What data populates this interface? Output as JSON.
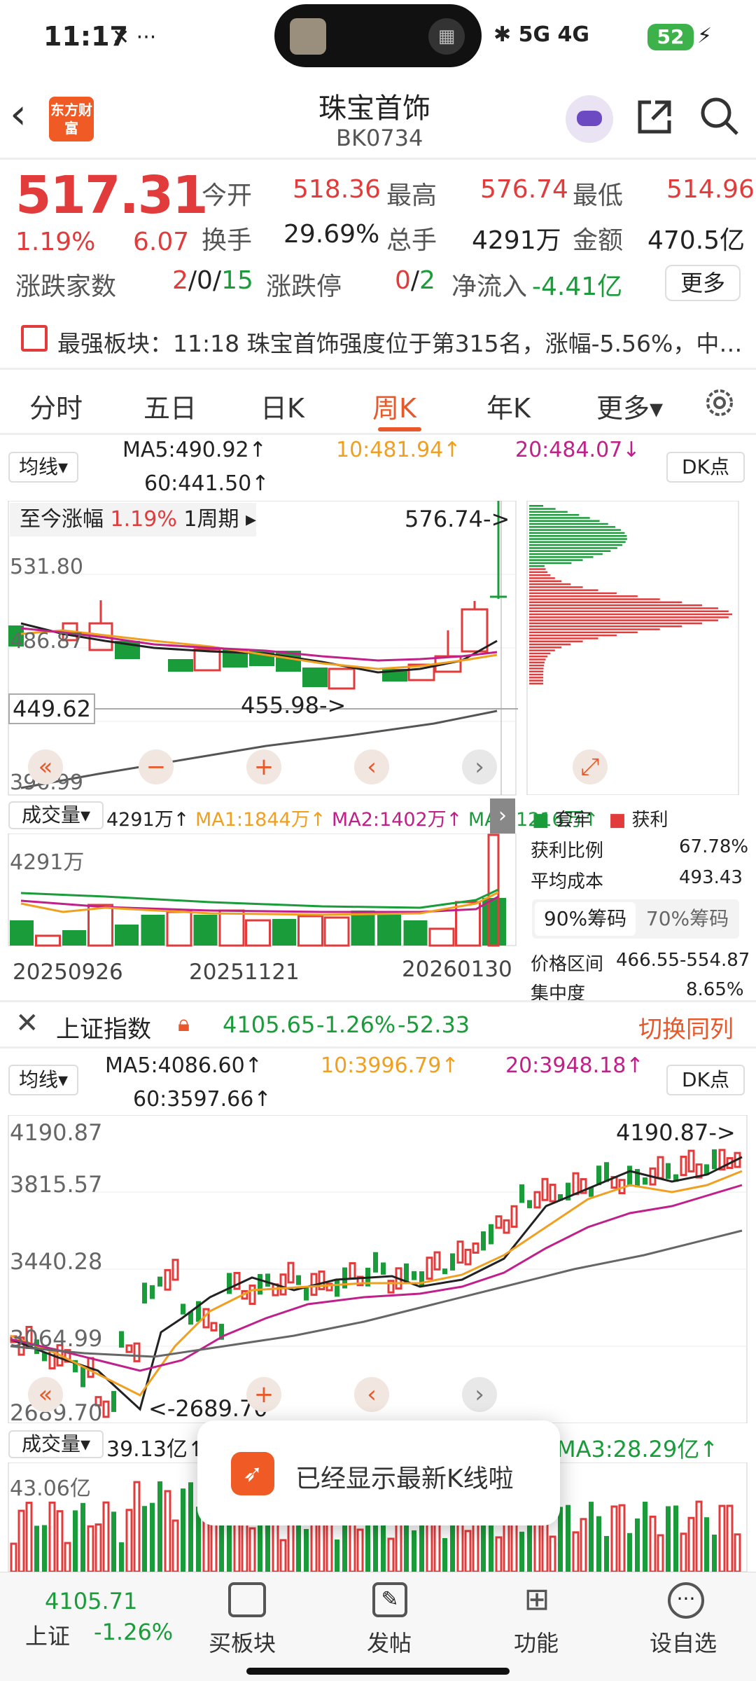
{
  "status": {
    "time": "11:17",
    "battery": "52",
    "signal": "5G 4G"
  },
  "header": {
    "title": "珠宝首饰",
    "code": "BK0734",
    "logo_text": "东方财富"
  },
  "quote": {
    "price": "517.31",
    "pct": "1.19%",
    "change": "6.07",
    "open_label": "今开",
    "open": "518.36",
    "high_label": "最高",
    "high": "576.74",
    "low_label": "最低",
    "low": "514.96",
    "turnover_label": "换手",
    "turnover": "29.69%",
    "volume_label": "总手",
    "volume": "4291万",
    "amount_label": "金额",
    "amount": "470.5亿",
    "updown_label": "涨跌家数",
    "up": "2",
    "flat": "0",
    "down": "15",
    "limit_label": "涨跌停",
    "limit_up": "0",
    "limit_down": "2",
    "inflow_label": "净流入",
    "inflow": "-4.41亿",
    "more": "更多"
  },
  "notice": {
    "text": "最强板块：11:18 珠宝首饰强度位于第315名，涨幅-5.56%，中…"
  },
  "tabs": {
    "t1": "分时",
    "t2": "五日",
    "t3": "日K",
    "t4": "周K",
    "t5": "年K",
    "t6": "更多▾"
  },
  "main_chart": {
    "ma_selector": "均线▾",
    "ma5": "MA5:490.92↑",
    "ma10": "10:481.94↑",
    "ma20": "20:484.07↓",
    "ma60": "60:441.50↑",
    "dk": "DK点",
    "since_label": "至今涨幅",
    "since_pct": "1.19%",
    "since_period": "1周期 ▸",
    "y_top": "531.80",
    "y_mid": "486.87",
    "y_low": "396.99",
    "price_line": "449.62",
    "max_note": "576.74->",
    "min_note": "455.98->",
    "vol_selector": "成交量▾",
    "vol_val": "4291万↑",
    "vma1": "MA1:1844万↑",
    "vma2": "MA2:1402万↑",
    "vma3": "MA3:1216万↑",
    "vol_axis": "4291万",
    "dates": [
      "20250926",
      "20251121",
      "20260130"
    ]
  },
  "chip": {
    "legend_trap": "套牢",
    "legend_profit": "获利",
    "profit_ratio_label": "获利比例",
    "profit_ratio": "67.78%",
    "avg_cost_label": "平均成本",
    "avg_cost": "493.43",
    "tab90": "90%筹码",
    "tab70": "70%筹码",
    "range_label": "价格区间",
    "range": "466.55-554.87",
    "conc_label": "集中度",
    "conc": "8.65%"
  },
  "index_bar": {
    "name": "上证指数",
    "price": "4105.65",
    "pct": "-1.26%",
    "chg": "-52.33",
    "switch": "切换同列"
  },
  "index_chart": {
    "ma_selector": "均线▾",
    "ma5": "MA5:4086.60↑",
    "ma10": "10:3996.79↑",
    "ma20": "20:3948.18↑",
    "ma60": "60:3597.66↑",
    "dk": "DK点",
    "y1": "4190.87",
    "y2": "3815.57",
    "y3": "3440.28",
    "y4": "3064.99",
    "y5": "2689.70",
    "max_note": "4190.87->",
    "min_note": "<-2689.70",
    "vol_selector": "成交量▾",
    "vol_val": "39.13亿↑",
    "vma3": "MA3:28.29亿↑",
    "vol_axis": "43.06亿"
  },
  "toast": {
    "text": "已经显示最新K线啦"
  },
  "bottom_nav": {
    "index_price": "4105.71",
    "index_name": "上证",
    "index_pct": "-1.26%",
    "buy": "买板块",
    "post": "发帖",
    "func": "功能",
    "watch": "设自选"
  },
  "colors": {
    "up": "#e23b3b",
    "down": "#1a9c3a",
    "accent": "#e8582a",
    "ma5": "#222222",
    "ma10": "#f0a020",
    "ma20": "#c0208a",
    "ma60": "#555555"
  }
}
